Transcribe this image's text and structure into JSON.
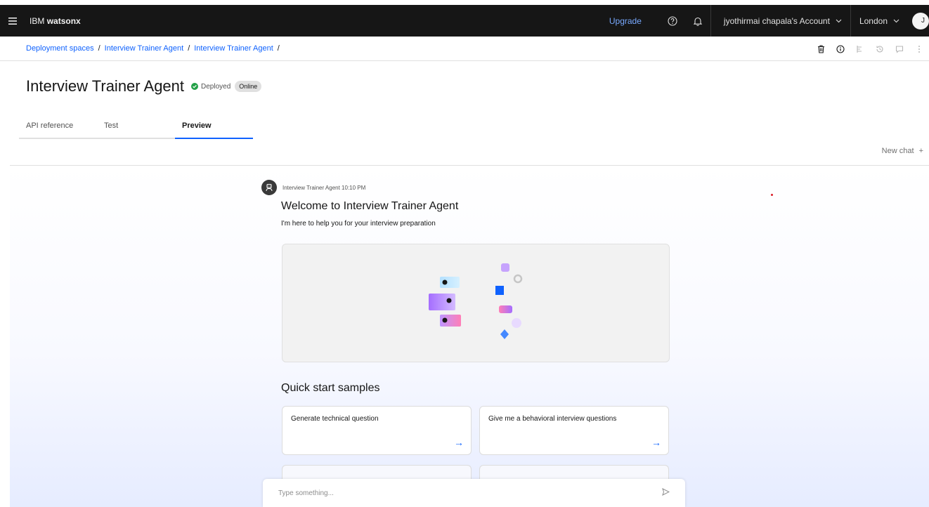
{
  "header": {
    "brand_prefix": "IBM",
    "brand_name": "watsonx",
    "upgrade": "Upgrade",
    "account": "jyothirmai chapala's Account",
    "region": "London",
    "avatar_initial": "J"
  },
  "breadcrumb": {
    "items": [
      "Deployment spaces",
      "Interview Trainer Agent",
      "Interview Trainer Agent"
    ],
    "separator": "/"
  },
  "page": {
    "title": "Interview Trainer Agent",
    "status": "Deployed",
    "badge": "Online"
  },
  "tabs": [
    {
      "label": "API reference",
      "active": false
    },
    {
      "label": "Test",
      "active": false
    },
    {
      "label": "Preview",
      "active": true
    }
  ],
  "new_chat": "New chat",
  "message": {
    "author_time": "Interview Trainer Agent 10:10 PM",
    "welcome": "Welcome to Interview Trainer Agent",
    "subtitle": "I'm here to help you for your interview preparation"
  },
  "quick_start": {
    "title": "Quick start samples",
    "cards": [
      "Generate technical question",
      "Give me a behavioral interview questions"
    ]
  },
  "input": {
    "placeholder": "Type something..."
  },
  "colors": {
    "accent": "#0f62fe",
    "topbar": "#161616",
    "status_green": "#24a148"
  }
}
